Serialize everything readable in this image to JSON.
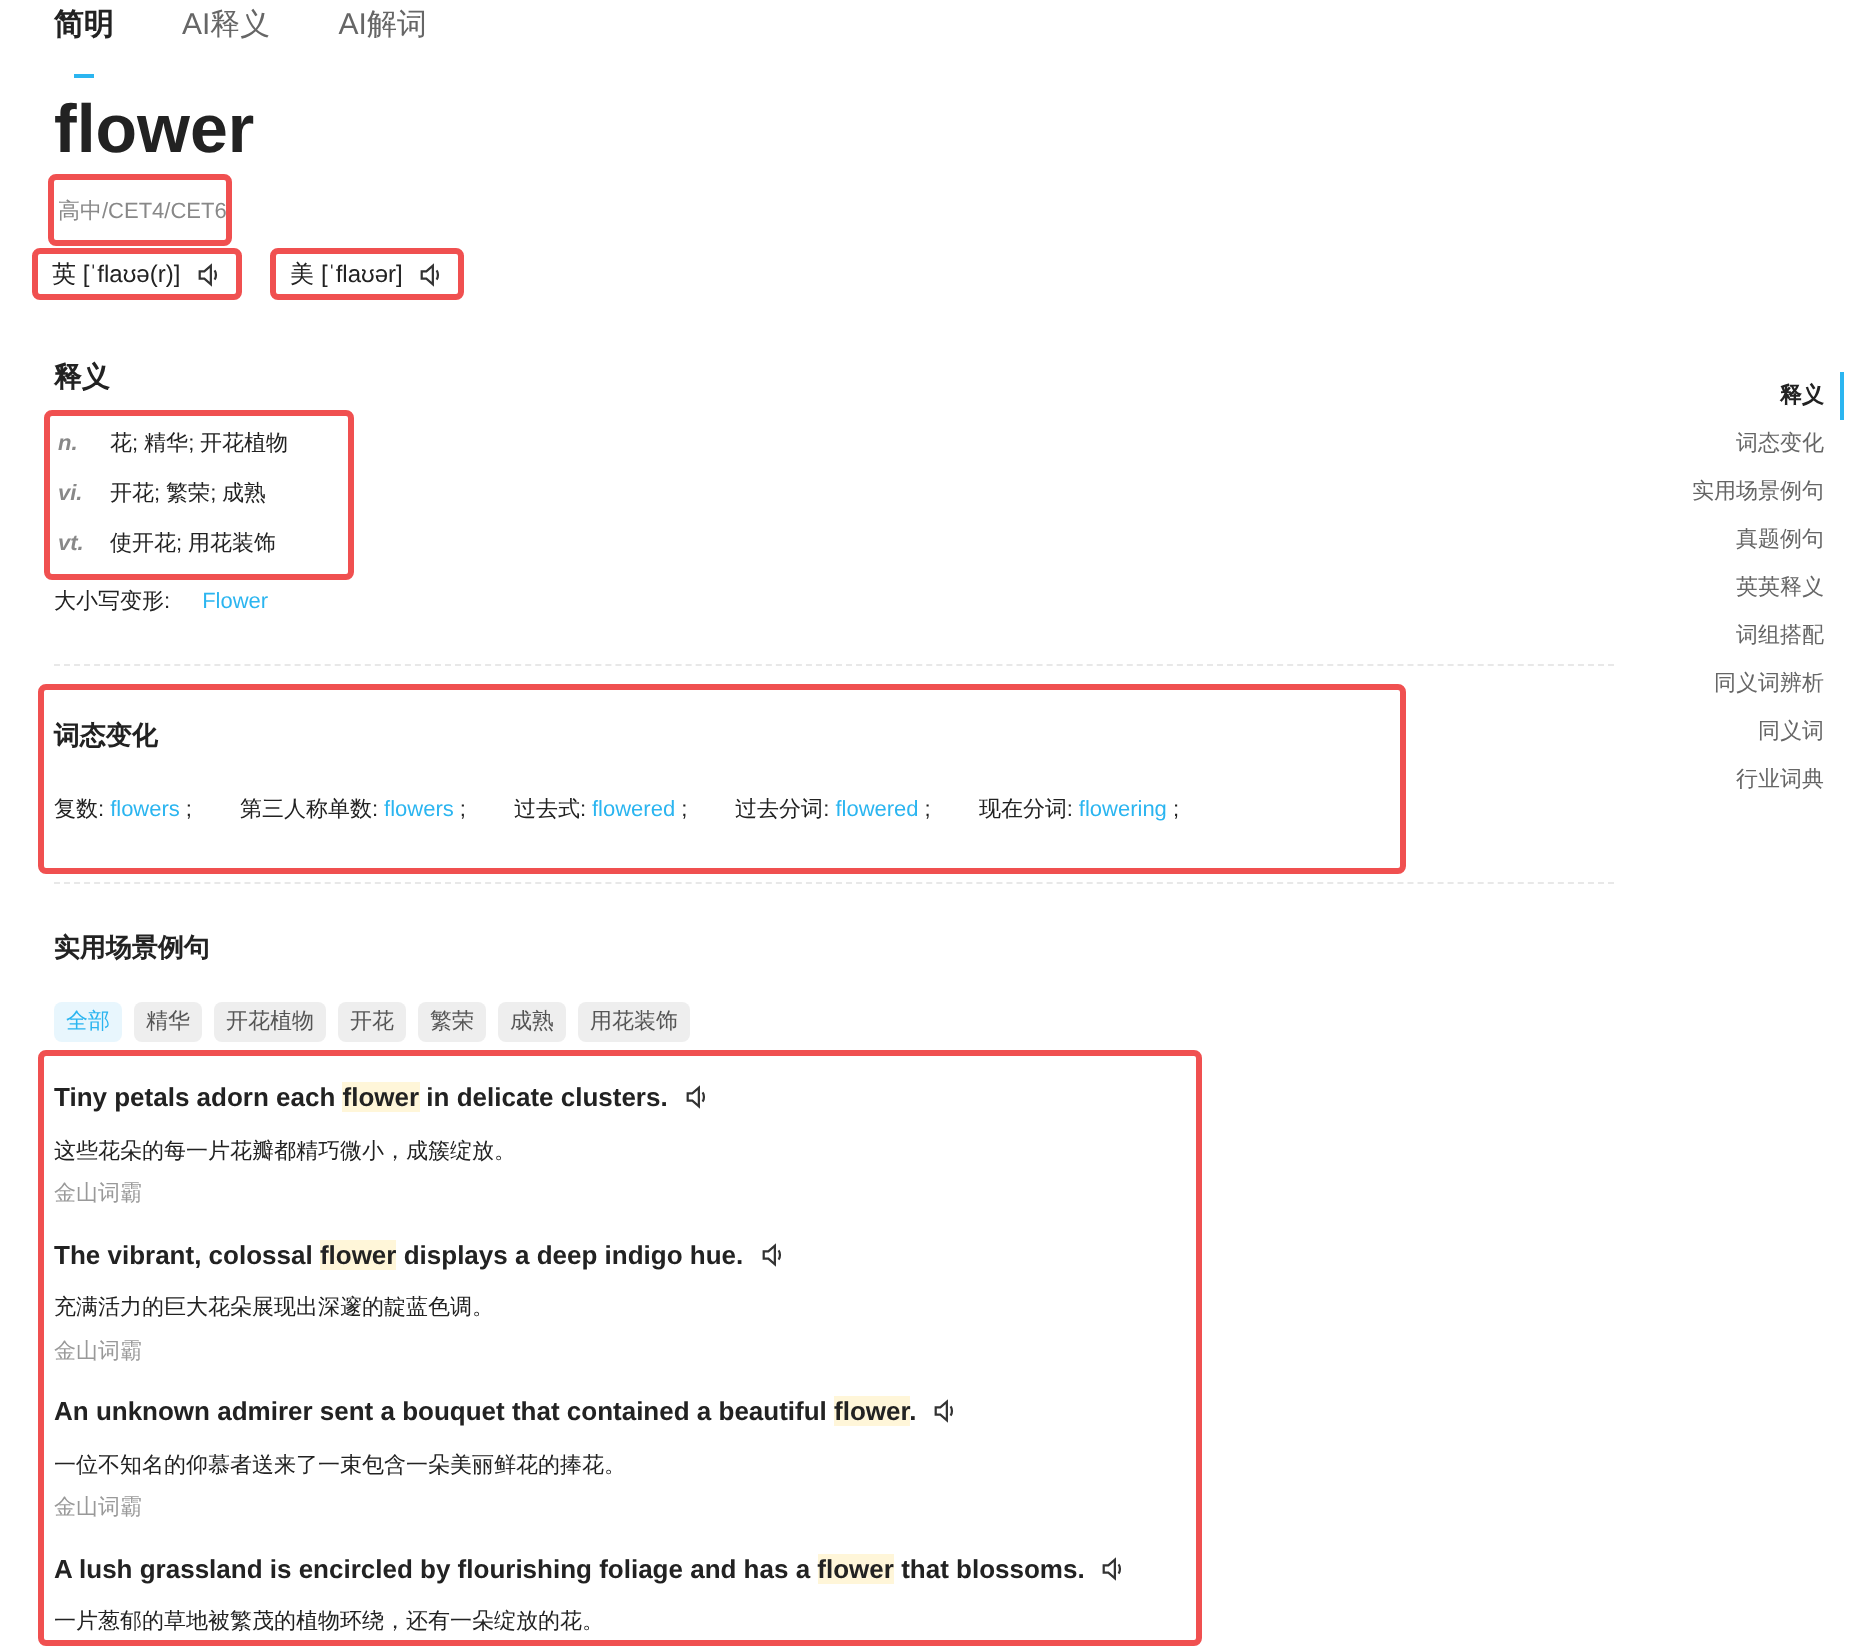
{
  "tabs": [
    {
      "label": "简明",
      "selected": true
    },
    {
      "label": "AI释义",
      "selected": false
    },
    {
      "label": "AI解词",
      "selected": false
    }
  ],
  "word": "flower",
  "levels": "高中/CET4/CET6",
  "pronunciations": [
    {
      "label": "英 [ˈflaʊə(r)]"
    },
    {
      "label": "美 [ˈflaʊər]"
    }
  ],
  "definitions": {
    "title": "释义",
    "items": [
      {
        "pos": "n.",
        "meaning": "花; 精华; 开花植物"
      },
      {
        "pos": "vi.",
        "meaning": "开花; 繁荣; 成熟"
      },
      {
        "pos": "vt.",
        "meaning": "使开花; 用花装饰"
      }
    ],
    "case_label": "大小写变形:",
    "case_value": "Flower"
  },
  "inflections": {
    "title": "词态变化",
    "items": [
      {
        "label": "复数:",
        "value": "flowers",
        "separator": ";"
      },
      {
        "label": "第三人称单数:",
        "value": "flowers",
        "separator": ";"
      },
      {
        "label": "过去式:",
        "value": "flowered",
        "separator": ";"
      },
      {
        "label": "过去分词:",
        "value": "flowered",
        "separator": ";"
      },
      {
        "label": "现在分词:",
        "value": "flowering",
        "separator": ";"
      }
    ]
  },
  "examples": {
    "title": "实用场景例句",
    "filters": [
      {
        "label": "全部",
        "selected": true
      },
      {
        "label": "精华",
        "selected": false
      },
      {
        "label": "开花植物",
        "selected": false
      },
      {
        "label": "开花",
        "selected": false
      },
      {
        "label": "繁荣",
        "selected": false
      },
      {
        "label": "成熟",
        "selected": false
      },
      {
        "label": "用花装饰",
        "selected": false
      }
    ],
    "sentences": [
      {
        "before": "Tiny petals adorn each ",
        "highlight": "flower",
        "after": " in delicate clusters.",
        "translation": "这些花朵的每一片花瓣都精巧微小，成簇绽放。",
        "source": "金山词霸"
      },
      {
        "before": "The vibrant, colossal ",
        "highlight": "flower",
        "after": " displays a deep indigo hue.",
        "translation": "充满活力的巨大花朵展现出深邃的靛蓝色调。",
        "source": "金山词霸"
      },
      {
        "before": "An unknown admirer sent a bouquet that contained a beautiful ",
        "highlight": "flower",
        "after": ".",
        "translation": "一位不知名的仰慕者送来了一束包含一朵美丽鲜花的捧花。",
        "source": "金山词霸"
      },
      {
        "before": "A lush grassland is encircled by flourishing foliage and has a ",
        "highlight": "flower",
        "after": " that blossoms.",
        "translation": "一片葱郁的草地被繁茂的植物环绕，还有一朵绽放的花。"
      }
    ]
  },
  "nav": [
    {
      "label": "释义",
      "selected": true
    },
    {
      "label": "词态变化",
      "selected": false
    },
    {
      "label": "实用场景例句",
      "selected": false
    },
    {
      "label": "真题例句",
      "selected": false
    },
    {
      "label": "英英释义",
      "selected": false
    },
    {
      "label": "词组搭配",
      "selected": false
    },
    {
      "label": "同义词辨析",
      "selected": false
    },
    {
      "label": "同义词",
      "selected": false
    },
    {
      "label": "行业词典",
      "selected": false
    }
  ]
}
